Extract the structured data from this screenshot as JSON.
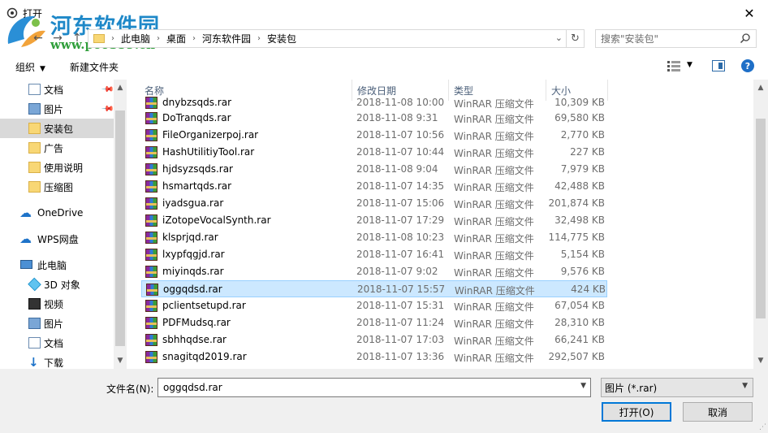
{
  "window": {
    "title": "打开",
    "close_glyph": "✕"
  },
  "watermark": {
    "name": "河东软件园",
    "url": "www.pc0359.cn"
  },
  "addressbar": {
    "breadcrumbs": [
      "此电脑",
      "桌面",
      "河东软件园",
      "安装包"
    ],
    "search_placeholder": "搜索\"安装包\""
  },
  "toolbar": {
    "organize_label": "组织",
    "new_folder_label": "新建文件夹"
  },
  "navpane": {
    "items": [
      {
        "label": "文档",
        "icon": "document-icon",
        "pinned": true
      },
      {
        "label": "图片",
        "icon": "pictures-icon",
        "pinned": true
      },
      {
        "label": "安装包",
        "icon": "folder-icon",
        "selected": true
      },
      {
        "label": "广告",
        "icon": "folder-icon"
      },
      {
        "label": "使用说明",
        "icon": "folder-icon"
      },
      {
        "label": "压缩图",
        "icon": "folder-icon"
      },
      {
        "label": "OneDrive",
        "icon": "onedrive-icon"
      },
      {
        "label": "WPS网盘",
        "icon": "wps-cloud-icon"
      },
      {
        "label": "此电脑",
        "icon": "this-pc-icon"
      },
      {
        "label": "3D 对象",
        "icon": "3d-objects-icon"
      },
      {
        "label": "视频",
        "icon": "videos-icon"
      },
      {
        "label": "图片",
        "icon": "pictures-icon"
      },
      {
        "label": "文档",
        "icon": "document-icon"
      },
      {
        "label": "下载",
        "icon": "downloads-icon"
      }
    ]
  },
  "filelist": {
    "columns": {
      "name": "名称",
      "date": "修改日期",
      "type": "类型",
      "size": "大小"
    },
    "rows": [
      {
        "name": "dnybzsqds.rar",
        "date": "2018-11-08 10:00",
        "type": "WinRAR 压缩文件",
        "size": "10,309 KB"
      },
      {
        "name": "DoTranqds.rar",
        "date": "2018-11-08 9:31",
        "type": "WinRAR 压缩文件",
        "size": "69,580 KB"
      },
      {
        "name": "FileOrganizerpoj.rar",
        "date": "2018-11-07 10:56",
        "type": "WinRAR 压缩文件",
        "size": "2,770 KB"
      },
      {
        "name": "HashUtilitiyTool.rar",
        "date": "2018-11-07 10:44",
        "type": "WinRAR 压缩文件",
        "size": "227 KB"
      },
      {
        "name": "hjdsyzsqds.rar",
        "date": "2018-11-08 9:04",
        "type": "WinRAR 压缩文件",
        "size": "7,979 KB"
      },
      {
        "name": "hsmartqds.rar",
        "date": "2018-11-07 14:35",
        "type": "WinRAR 压缩文件",
        "size": "42,488 KB"
      },
      {
        "name": "iyadsgua.rar",
        "date": "2018-11-07 15:06",
        "type": "WinRAR 压缩文件",
        "size": "201,874 KB"
      },
      {
        "name": "iZotopeVocalSynth.rar",
        "date": "2018-11-07 17:29",
        "type": "WinRAR 压缩文件",
        "size": "32,498 KB"
      },
      {
        "name": "klsprjqd.rar",
        "date": "2018-11-08 10:23",
        "type": "WinRAR 压缩文件",
        "size": "114,775 KB"
      },
      {
        "name": "lxypfqgjd.rar",
        "date": "2018-11-07 16:41",
        "type": "WinRAR 压缩文件",
        "size": "5,154 KB"
      },
      {
        "name": "miyinqds.rar",
        "date": "2018-11-07 9:02",
        "type": "WinRAR 压缩文件",
        "size": "9,576 KB"
      },
      {
        "name": "oggqdsd.rar",
        "date": "2018-11-07 15:57",
        "type": "WinRAR 压缩文件",
        "size": "424 KB",
        "selected": true
      },
      {
        "name": "pclientsetupd.rar",
        "date": "2018-11-07 15:31",
        "type": "WinRAR 压缩文件",
        "size": "67,054 KB"
      },
      {
        "name": "PDFMudsq.rar",
        "date": "2018-11-07 11:24",
        "type": "WinRAR 压缩文件",
        "size": "28,310 KB"
      },
      {
        "name": "sbhhqdse.rar",
        "date": "2018-11-07 17:03",
        "type": "WinRAR 压缩文件",
        "size": "66,241 KB"
      },
      {
        "name": "snagitqd2019.rar",
        "date": "2018-11-07 13:36",
        "type": "WinRAR 压缩文件",
        "size": "292,507 KB"
      }
    ]
  },
  "footer": {
    "filename_label": "文件名(N):",
    "filename_value": "oggqdsd.rar",
    "filter_value": "图片 (*.rar)",
    "open_label": "打开(O)",
    "cancel_label": "取消"
  }
}
